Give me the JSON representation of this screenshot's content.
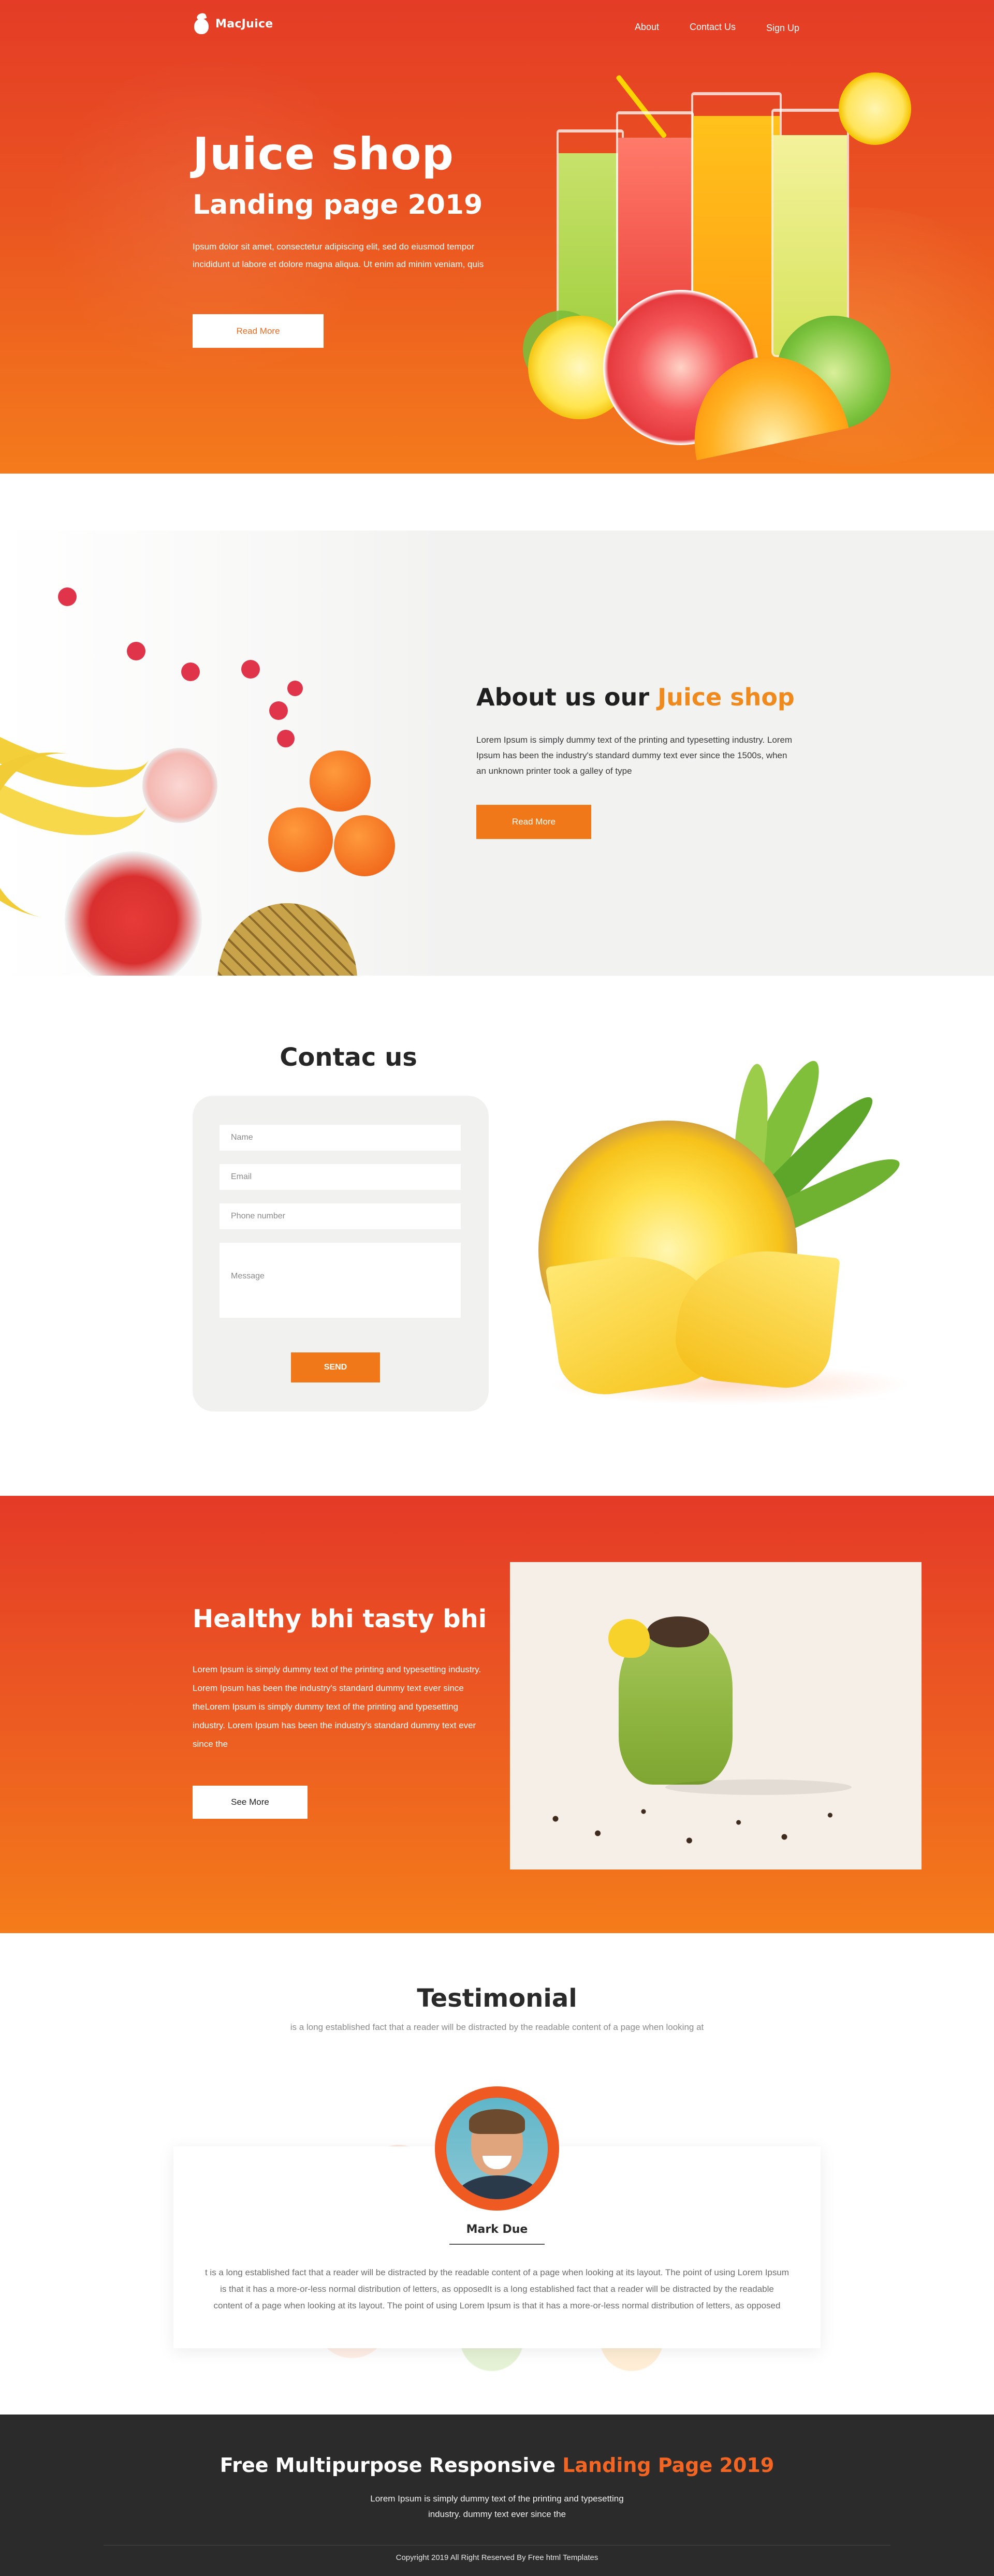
{
  "header": {
    "logo_text": "MacJuice",
    "nav": {
      "about": "About",
      "contact": "Contact Us",
      "signup": "Sign Up"
    }
  },
  "hero": {
    "title": "Juice shop",
    "subtitle": "Landing page 2019",
    "text": "Ipsum dolor sit amet, consectetur adipiscing elit, sed do eiusmod tempor incididunt ut labore et dolore magna aliqua. Ut enim ad minim veniam, quis",
    "button": "Read More"
  },
  "about": {
    "title_plain": "About us our",
    "title_accent": "Juice shop",
    "text": "Lorem Ipsum is simply dummy text of the printing and typesetting industry. Lorem Ipsum has been the industry's standard dummy text ever since the 1500s, when an unknown printer took a galley of type",
    "button": "Read More"
  },
  "contact": {
    "title": "Contac us",
    "name_placeholder": "Name",
    "email_placeholder": "Email",
    "phone_placeholder": "Phone number",
    "message_placeholder": "Message",
    "send": "SEND"
  },
  "healthy": {
    "title": "Healthy bhi tasty bhi",
    "text": "Lorem Ipsum is simply dummy text of the printing and typesetting industry. Lorem Ipsum has been the industry's standard dummy text ever since theLorem Ipsum is simply dummy text of the printing and typesetting industry. Lorem Ipsum has been the industry's standard dummy text ever since the",
    "button": "See More"
  },
  "testimonial": {
    "title": "Testimonial",
    "subtitle": "is a long established fact that a reader will be distracted by the readable content of a page when looking at",
    "name": "Mark Due",
    "quote": "t is a long established fact that a reader will be distracted by the readable content of a page when looking at its layout. The point of using Lorem Ipsum is that it has a more-or-less normal distribution of letters, as opposedIt is a long established fact that a reader will be distracted by the readable content of a page when looking at its layout. The point of using Lorem Ipsum is that it has a more-or-less normal distribution of letters, as opposed"
  },
  "footer": {
    "title_plain": "Free Multipurpose Responsive",
    "title_accent": "Landing Page 2019",
    "text_line1": "Lorem Ipsum is simply dummy text of the printing and typesetting",
    "text_line2": "industry.  dummy text ever since the",
    "copyright": "Copyright 2019 All Right Reserved By Free  html Templates"
  },
  "colors": {
    "brand_red": "#e43c26",
    "brand_orange": "#f47b1c",
    "accent_orange": "#f08a1c",
    "button_orange": "#f07819",
    "footer_bg": "#2b2b2b"
  },
  "icons": [
    "pineapple-logo-icon"
  ]
}
